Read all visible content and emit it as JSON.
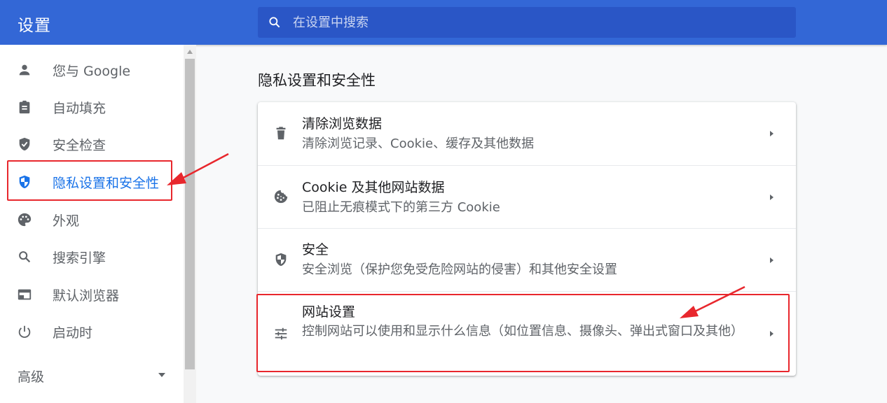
{
  "header": {
    "title": "设置",
    "search_placeholder": "在设置中搜索"
  },
  "sidebar": {
    "items": [
      {
        "label": "您与 Google",
        "icon": "person-icon"
      },
      {
        "label": "自动填充",
        "icon": "clipboard-icon"
      },
      {
        "label": "安全检查",
        "icon": "shield-check-icon"
      },
      {
        "label": "隐私设置和安全性",
        "icon": "shield-half-icon",
        "active": true
      },
      {
        "label": "外观",
        "icon": "palette-icon"
      },
      {
        "label": "搜索引擎",
        "icon": "search-icon"
      },
      {
        "label": "默认浏览器",
        "icon": "browser-icon"
      },
      {
        "label": "启动时",
        "icon": "power-icon"
      }
    ],
    "advanced_label": "高级"
  },
  "main": {
    "section_title": "隐私设置和安全性",
    "rows": [
      {
        "title": "清除浏览数据",
        "subtitle": "清除浏览记录、Cookie、缓存及其他数据",
        "icon": "trash-icon"
      },
      {
        "title": "Cookie 及其他网站数据",
        "subtitle": "已阻止无痕模式下的第三方 Cookie",
        "icon": "cookie-icon"
      },
      {
        "title": "安全",
        "subtitle": "安全浏览（保护您免受危险网站的侵害）和其他安全设置",
        "icon": "security-shield-icon"
      },
      {
        "title": "网站设置",
        "subtitle": "控制网站可以使用和显示什么信息（如位置信息、摄像头、弹出式窗口及其他）",
        "icon": "tune-icon"
      }
    ]
  },
  "colors": {
    "header_bg": "#3367d6",
    "accent": "#1a73e8",
    "annotation": "#e8272d"
  }
}
